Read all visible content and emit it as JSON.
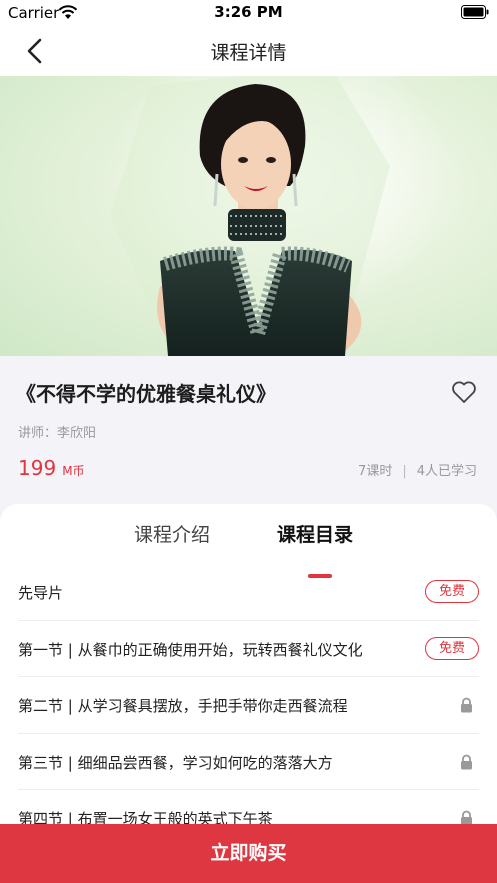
{
  "status_bar": {
    "carrier": "Carrier",
    "time": "3:26 PM"
  },
  "nav": {
    "title": "课程详情",
    "back_icon": "chevron-left-icon"
  },
  "course": {
    "title": "《不得不学的优雅餐桌礼仪》",
    "teacher": "讲师：李欣阳",
    "price": "199",
    "price_unit": "M币",
    "lessons_count": "7课时",
    "learners": "4人已学习",
    "favorite_icon": "heart-outline-icon"
  },
  "tabs": [
    {
      "label": "课程介绍",
      "active": false
    },
    {
      "label": "课程目录",
      "active": true
    }
  ],
  "lessons": [
    {
      "title": "先导片",
      "badge": "免费",
      "locked": false
    },
    {
      "title": "第一节 | 从餐巾的正确使用开始，玩转西餐礼仪文化",
      "badge": "免费",
      "locked": false
    },
    {
      "title": "第二节 | 从学习餐具摆放，手把手带你走西餐流程",
      "badge": "",
      "locked": true
    },
    {
      "title": "第三节 | 细细品尝西餐，学习如何吃的落落大方",
      "badge": "",
      "locked": true
    },
    {
      "title": "第四节 | 布置一场女王般的英式下午茶",
      "badge": "",
      "locked": true
    }
  ],
  "buy_button": {
    "label": "立即购买"
  },
  "colors": {
    "accent": "#e0343f",
    "buy_bar": "#de3741",
    "hero_bg": "#e6f2dc"
  }
}
